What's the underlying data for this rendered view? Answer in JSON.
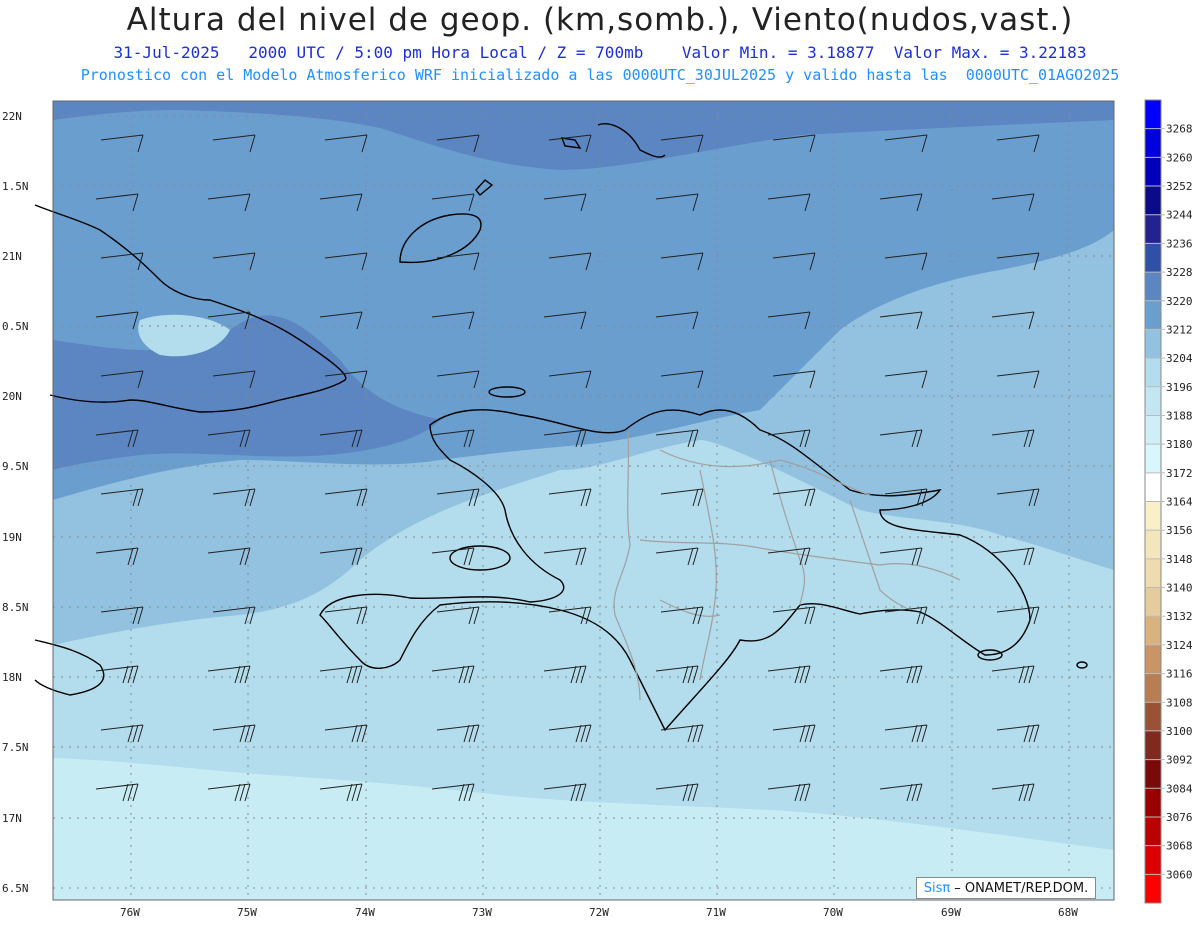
{
  "header": {
    "title": "Altura del nivel de geop. (km,somb.), Viento(nudos,vast.)",
    "line1": "31-Jul-2025   2000 UTC / 5:00 pm Hora Local / Z = 700mb    Valor Min. = 3.18877  Valor Max. = 3.22183",
    "line2": "Pronostico con el Modelo Atmosferico WRF inicializado a las 0000UTC_30JUL2025 y valido hasta las  0000UTC_01AGO2025"
  },
  "map": {
    "lat_labels": [
      "22N",
      "1.5N",
      "21N",
      "0.5N",
      "20N",
      "9.5N",
      "19N",
      "8.5N",
      "18N",
      "7.5N",
      "17N",
      "6.5N"
    ],
    "lon_labels": [
      "76W",
      "75W",
      "74W",
      "73W",
      "72W",
      "71W",
      "70W",
      "69W",
      "68W"
    ],
    "colors": {
      "band_3220": "#5b86c2",
      "band_3212": "#6a9ecf",
      "band_3204": "#92c2e0",
      "band_3196": "#b3dcec",
      "band_3188": "#c8ecf4",
      "coast": "#000000",
      "borders": "#a0a0a0"
    }
  },
  "colorbar": {
    "labels": [
      "3268",
      "3260",
      "3252",
      "3244",
      "3236",
      "3228",
      "3220",
      "3212",
      "3204",
      "3196",
      "3188",
      "3180",
      "3172",
      "3164",
      "3156",
      "3148",
      "3140",
      "3132",
      "3124",
      "3116",
      "3108",
      "3100",
      "3092",
      "3084",
      "3076",
      "3068",
      "3060"
    ],
    "colors": [
      "#0000ff",
      "#0000dd",
      "#0000bb",
      "#0a0a8a",
      "#23238f",
      "#3050a8",
      "#5b86c2",
      "#6a9ecf",
      "#92c2e0",
      "#b3dcec",
      "#c3e7f2",
      "#cfeff6",
      "#d7f7fb",
      "#ffffff",
      "#faf0c8",
      "#f4e6bc",
      "#eedbb0",
      "#e6cc9c",
      "#dab27e",
      "#c99566",
      "#b87d52",
      "#9a5236",
      "#7f2a1f",
      "#7a0a0a",
      "#990000",
      "#bb0000",
      "#dd0000",
      "#ff0000"
    ]
  },
  "credit": {
    "sis": "Sisπ",
    "org": "– ONAMET/REP.DOM."
  }
}
